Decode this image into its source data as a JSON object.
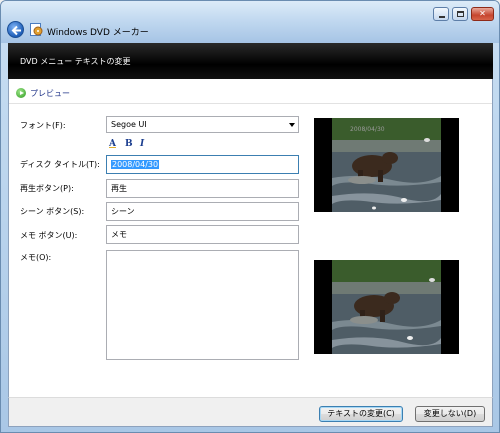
{
  "window": {
    "title": "Windows DVD メーカー",
    "controls": {
      "close_glyph": "✕"
    }
  },
  "header": {
    "title": "DVD メニュー テキストの変更"
  },
  "preview": {
    "label": "プレビュー"
  },
  "form": {
    "font_label": "フォント(F):",
    "font_value": "Segoe UI",
    "format_buttons": {
      "color": "A",
      "bold": "B",
      "italic": "I"
    },
    "disc_title_label": "ディスク タイトル(T):",
    "disc_title_value": "2008/04/30",
    "play_button_label": "再生ボタン(P):",
    "play_button_value": "再生",
    "scene_button_label": "シーン ボタン(S):",
    "scene_button_value": "シーン",
    "notes_button_label": "メモ ボタン(U):",
    "notes_button_value": "メモ",
    "notes_label": "メモ(O):",
    "notes_value": ""
  },
  "thumbnails": {
    "overlay_date": "2008/04/30"
  },
  "footer": {
    "change_text_button": "テキストの変更(C)",
    "cancel_button": "変更しない(D)"
  },
  "colors": {
    "header_band": "#000000",
    "preview_label": "#1e3287",
    "selection": "#3399ff"
  }
}
